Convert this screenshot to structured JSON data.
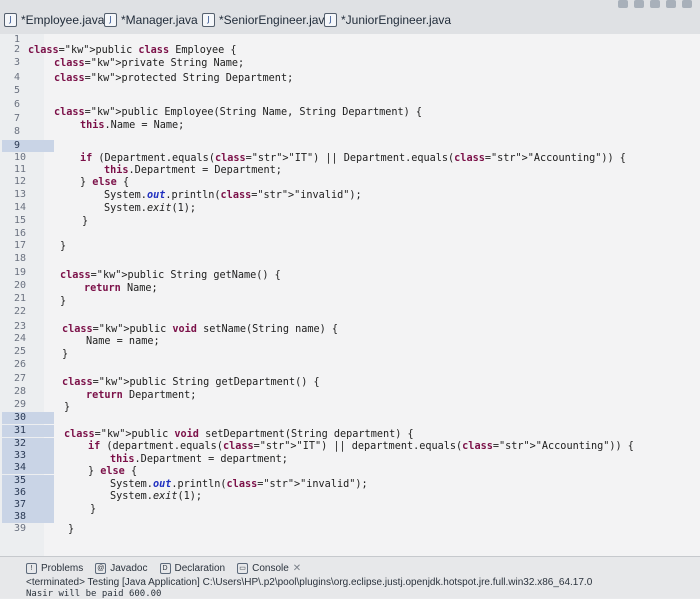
{
  "tabs": [
    {
      "label": "*Employee.java",
      "active": true,
      "icon": "java-file-icon",
      "close": "✕"
    },
    {
      "label": "*Manager.java",
      "active": false,
      "icon": "java-file-icon"
    },
    {
      "label": "*SeniorEngineer.java",
      "active": false,
      "icon": "java-file-icon"
    },
    {
      "label": "*JuniorEngineer.java",
      "active": false,
      "icon": "java-file-icon"
    }
  ],
  "editor": {
    "line_numbers": [
      "1",
      "2",
      "3",
      "4",
      "5",
      "6",
      "7",
      "8",
      "9",
      "10",
      "11",
      "12",
      "13",
      "14",
      "15",
      "16",
      "17",
      "18",
      "19",
      "20",
      "21",
      "22",
      "23",
      "24",
      "25",
      "26",
      "27",
      "28",
      "29",
      "30",
      "31",
      "32",
      "33",
      "34",
      "35",
      "36",
      "37",
      "38",
      "39"
    ],
    "code": {
      "l2": "public class Employee {",
      "l3": "private String Name;",
      "l4": "protected String Department;",
      "l6": "public Employee(String Name, String Department) {",
      "l7": "this.Name = Name;",
      "l9": "if (Department.equals(\"IT\") || Department.equals(\"Accounting\")) {",
      "l10": "this.Department = Department;",
      "l11": "} else {",
      "l12": "System.out.println(\"invalid\");",
      "l13": "System.exit(1);",
      "l14": "}",
      "l16": "}",
      "l18": "public String getName() {",
      "l19": "return Name;",
      "l20": "}",
      "l22": "public void setName(String name) {",
      "l23": "Name = name;",
      "l24": "}",
      "l26": "public String getDepartment() {",
      "l27": "return Department;",
      "l28": "}",
      "l30": "public void setDepartment(String department) {",
      "l31": "if (department.equals(\"IT\") || department.equals(\"Accounting\")) {",
      "l32": "this.Department = department;",
      "l33": "} else {",
      "l34": "System.out.println(\"invalid\");",
      "l35": "System.exit(1);",
      "l36": "}",
      "l38": "}"
    }
  },
  "bottom": {
    "tabs": [
      "Problems",
      "Javadoc",
      "Declaration",
      "Console"
    ],
    "console_close": "✕",
    "status_line": "<terminated> Testing [Java Application] C:\\Users\\HP\\.p2\\pool\\plugins\\org.eclipse.justj.openjdk.hotspot.jre.full.win32.x86_64.17.0",
    "output_line": "Nasir will be paid 600.00"
  },
  "colors": {
    "keyword": "#7b1048",
    "field": "#2030c0",
    "string": "#2a00c8",
    "selection": "#c9d4e6"
  }
}
